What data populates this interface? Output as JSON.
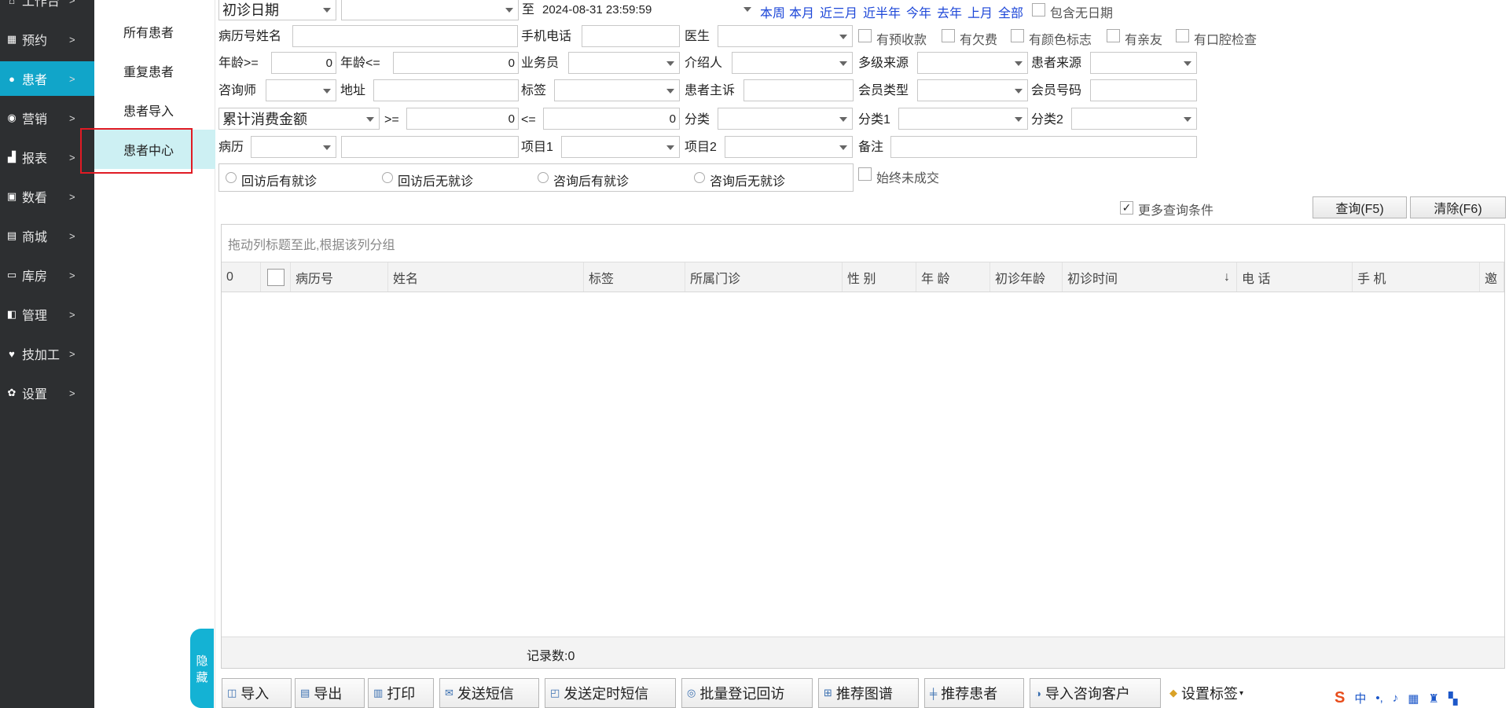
{
  "nav": {
    "items": [
      {
        "label": "工作台",
        "icon": "home-icon"
      },
      {
        "label": "预约",
        "icon": "calendar-icon"
      },
      {
        "label": "患者",
        "icon": "user-icon"
      },
      {
        "label": "营销",
        "icon": "marketing-icon"
      },
      {
        "label": "报表",
        "icon": "chart-icon"
      },
      {
        "label": "数看",
        "icon": "monitor-icon"
      },
      {
        "label": "商城",
        "icon": "cart-icon"
      },
      {
        "label": "库房",
        "icon": "box-icon"
      },
      {
        "label": "管理",
        "icon": "manage-icon"
      },
      {
        "label": "技加工",
        "icon": "tooth-icon"
      },
      {
        "label": "设置",
        "icon": "gear-icon"
      }
    ],
    "arrow": ">"
  },
  "submenu": {
    "items": [
      "所有患者",
      "重复患者",
      "患者导入",
      "患者中心"
    ]
  },
  "hide_tab": {
    "line1": "隐",
    "line2": "藏"
  },
  "filters": {
    "date_type": "初诊日期",
    "to_label": "至",
    "date_end": "2024-08-31 23:59:59",
    "quick_dates": [
      "本周",
      "本月",
      "近三月",
      "近半年",
      "今年",
      "去年",
      "上月",
      "全部"
    ],
    "include_no_date": "包含无日期",
    "record_name_label": "病历号姓名",
    "phone_label": "手机电话",
    "doctor_label": "医生",
    "has_prepay": "有预收款",
    "has_debt": "有欠费",
    "has_color_mark": "有颜色标志",
    "has_relative": "有亲友",
    "has_oral_exam": "有口腔检查",
    "age_ge_label": "年龄>=",
    "age_ge_value": "0",
    "age_le_label": "年龄<=",
    "age_le_value": "0",
    "salesman_label": "业务员",
    "referrer_label": "介绍人",
    "multi_source_label": "多级来源",
    "patient_source_label": "患者来源",
    "consultant_label": "咨询师",
    "address_label": "地址",
    "tag_label": "标签",
    "complaint_label": "患者主诉",
    "member_type_label": "会员类型",
    "member_no_label": "会员号码",
    "amount_type": "累计消费金额",
    "ge_label": ">=",
    "ge_value": "0",
    "le_label": "<=",
    "le_value": "0",
    "category_label": "分类",
    "category1_label": "分类1",
    "category2_label": "分类2",
    "record_label": "病历",
    "item1_label": "项目1",
    "item2_label": "项目2",
    "remark_label": "备注",
    "radios": [
      "回访后有就诊",
      "回访后无就诊",
      "咨询后有就诊",
      "咨询后无就诊"
    ],
    "never_deal": "始终未成交",
    "more_conditions": "更多查询条件",
    "query_btn": "查询(F5)",
    "clear_btn": "清除(F6)"
  },
  "grid": {
    "group_hint": "拖动列标题至此,根据该列分组",
    "columns": [
      "0",
      "",
      "病历号",
      "姓名",
      "标签",
      "所属门诊",
      "性 别",
      "年 龄",
      "初诊年龄",
      "初诊时间",
      "电 话",
      "手 机",
      "邀"
    ],
    "sort_arrow": "↓",
    "record_count": "记录数:0"
  },
  "toolbar": {
    "buttons": [
      {
        "label": "导入",
        "icon": "import-icon"
      },
      {
        "label": "导出",
        "icon": "export-icon"
      },
      {
        "label": "打印",
        "icon": "printer-icon"
      },
      {
        "label": "发送短信",
        "icon": "sms-icon"
      },
      {
        "label": "发送定时短信",
        "icon": "scheduled-sms-icon"
      },
      {
        "label": "批量登记回访",
        "icon": "revisit-icon"
      },
      {
        "label": "推荐图谱",
        "icon": "graph-icon"
      },
      {
        "label": "推荐患者",
        "icon": "recommend-icon"
      },
      {
        "label": "导入咨询客户",
        "icon": "import-customer-icon"
      },
      {
        "label": "设置标签",
        "icon": "tag-icon"
      }
    ]
  },
  "tray": {
    "ime": "中"
  }
}
